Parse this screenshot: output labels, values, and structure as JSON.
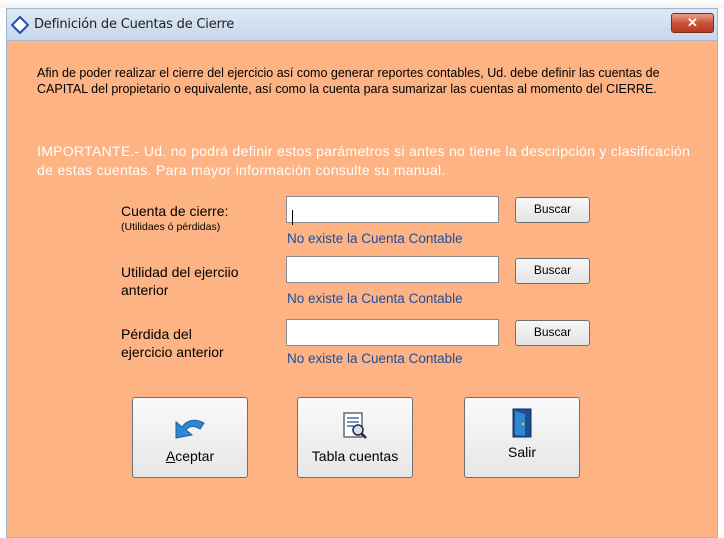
{
  "window": {
    "title": "Definición de Cuentas de Cierre",
    "close_label": "✕"
  },
  "intro_text": "Afin de poder realizar el cierre del ejercicio así como generar reportes contables, Ud. debe definir las cuentas de CAPITAL del propietario o equivalente, así como la cuenta para sumarizar las cuentas al momento del CIERRE.",
  "important_text": "IMPORTANTE.- Ud. no podrá definir estos parámetros si antes no tiene la descripción y clasificación de estas cuentas. Para mayor información consulte su manual.",
  "fields": [
    {
      "label": "Cuenta de cierre:",
      "sublabel": "(Utilidaes ó pérdidas)",
      "value": "",
      "button": "Buscar",
      "message": "No existe la Cuenta Contable"
    },
    {
      "label_line1": "Utilidad del ejerciio",
      "label_line2": "anterior",
      "value": "",
      "button": "Buscar",
      "message": "No existe la Cuenta Contable"
    },
    {
      "label_line1": "Pérdida del",
      "label_line2": "ejercicio anterior",
      "value": "",
      "button": "Buscar",
      "message": "No existe la Cuenta Contable"
    }
  ],
  "actions": {
    "accept_label": "Aceptar",
    "accounts_table_label": "Tabla cuentas",
    "exit_label": "Salir"
  },
  "colors": {
    "window_bg": "#fdb383",
    "message_text": "#1e4e9a",
    "important_text": "#ffffff"
  }
}
